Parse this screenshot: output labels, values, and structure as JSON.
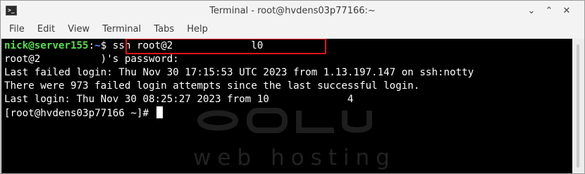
{
  "window": {
    "title": "Terminal - root@hvdens03p77166:~",
    "app_icon_glyph": ">_",
    "controls": {
      "minimize": "⌄",
      "maximize": "⌃",
      "close": "✕"
    }
  },
  "menu": [
    "File",
    "Edit",
    "View",
    "Terminal",
    "Tabs",
    "Help"
  ],
  "terminal": {
    "line1": {
      "user_host": "nick@server155",
      "colon": ":",
      "path": "~",
      "dollar": "$ ",
      "command": "ssh root@2",
      "redacted": "             ",
      "command_end": "l0"
    },
    "line2": {
      "start": "root@2",
      "redacted": "          ",
      "end": ")'s password:"
    },
    "line3": "Last failed login: Thu Nov 30 17:15:53 UTC 2023 from 1.13.197.147 on ssh:notty",
    "line4": "There were 973 failed login attempts since the last successful login.",
    "line5": {
      "start": "Last login: Thu Nov 30 08:25:27 2023 from 10",
      "redacted": "             ",
      "end": "4"
    },
    "line6": "[root@hvdens03p77166 ~]# ",
    "watermark_text": "web hosting"
  },
  "colors": {
    "highlight_border": "#e8121e",
    "prompt_user": "#55e24c",
    "prompt_path": "#5a8cff",
    "terminal_bg": "#000000"
  }
}
